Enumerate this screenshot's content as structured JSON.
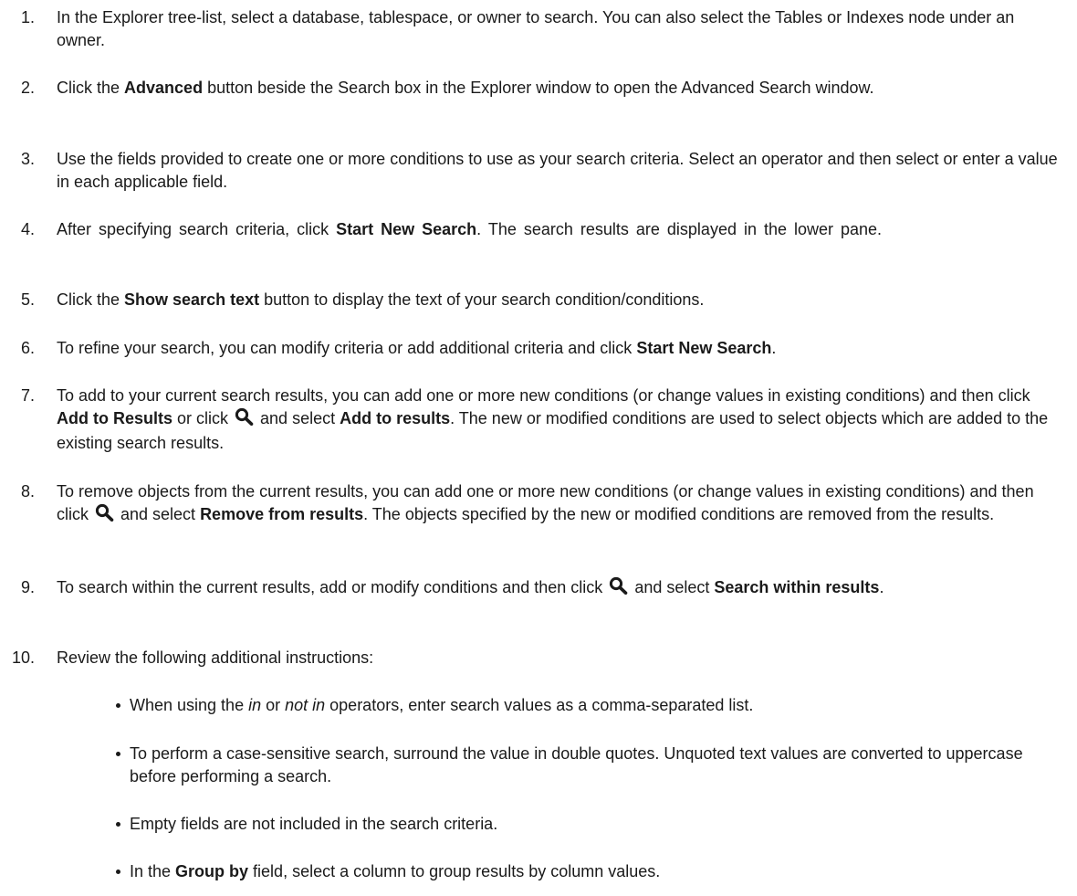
{
  "steps": [
    {
      "number": "1.",
      "parts": [
        {
          "t": "In the Explorer tree-list, select a database, tablespace, or owner to search. You can also select the Tables or Indexes node under an owner."
        }
      ]
    },
    {
      "number": "2.",
      "parts": [
        {
          "t": "Click the "
        },
        {
          "t": "Advanced",
          "b": true
        },
        {
          "t": " button beside the Search box in the Explorer window to open the Advanced Search window."
        }
      ]
    },
    {
      "number": "3.",
      "parts": [
        {
          "t": "Use the fields provided to create one or more conditions to use as your search criteria. Select an operator and then select or enter a value in each applicable field."
        }
      ]
    },
    {
      "number": "4.",
      "parts": [
        {
          "t": "After specifying search criteria, click "
        },
        {
          "t": "Start New Search",
          "b": true
        },
        {
          "t": ". The search results are displayed in the lower pane."
        }
      ]
    },
    {
      "number": "5.",
      "parts": [
        {
          "t": "Click the "
        },
        {
          "t": "Show search text",
          "b": true
        },
        {
          "t": " button to display the text of your search condition/conditions."
        }
      ]
    },
    {
      "number": "6.",
      "parts": [
        {
          "t": "To refine your search, you can modify criteria or add additional criteria and click "
        },
        {
          "t": "Start New Search",
          "b": true
        },
        {
          "t": "."
        }
      ]
    },
    {
      "number": "7.",
      "parts": [
        {
          "t": "To add to your current search results, you can add one or more new conditions (or change values in existing conditions) and then click "
        },
        {
          "t": "Add to Results",
          "b": true
        },
        {
          "t": " or click "
        },
        {
          "icon": "search-icon"
        },
        {
          "t": " and select "
        },
        {
          "t": "Add to results",
          "b": true
        },
        {
          "t": ". The new or modified conditions are used to select objects which are added to the existing search results."
        }
      ]
    },
    {
      "number": "8.",
      "parts": [
        {
          "t": "To remove objects from the current results, you can add one or more new conditions (or change values in existing conditions) and then click "
        },
        {
          "icon": "search-icon"
        },
        {
          "t": " and select "
        },
        {
          "t": "Remove from results",
          "b": true
        },
        {
          "t": ". The objects specified by the new or modified conditions are removed from the results."
        }
      ]
    },
    {
      "number": "9.",
      "parts": [
        {
          "t": "To search within the current results, add or modify conditions and then click "
        },
        {
          "icon": "search-icon"
        },
        {
          "t": " and select "
        },
        {
          "t": "Search within results",
          "b": true
        },
        {
          "t": "."
        }
      ]
    },
    {
      "number": "10.",
      "parts": [
        {
          "t": "Review the following additional instructions:"
        }
      ]
    }
  ],
  "bullets": [
    {
      "parts": [
        {
          "t": "When using the "
        },
        {
          "t": "in",
          "i": true
        },
        {
          "t": " or "
        },
        {
          "t": "not in",
          "i": true
        },
        {
          "t": " operators, enter search values as a comma-separated list."
        }
      ]
    },
    {
      "parts": [
        {
          "t": "To perform a case-sensitive search, surround the value in double quotes. Unquoted text values are converted to uppercase before performing a search."
        }
      ]
    },
    {
      "parts": [
        {
          "t": "Empty fields are not included in the search criteria."
        }
      ]
    },
    {
      "parts": [
        {
          "t": "In the "
        },
        {
          "t": "Group by",
          "b": true
        },
        {
          "t": " field, select a column to group results by column values."
        }
      ]
    }
  ],
  "colors": {
    "text": "#1a1a1a",
    "background": "#ffffff",
    "icon": "#1a1a1a"
  }
}
